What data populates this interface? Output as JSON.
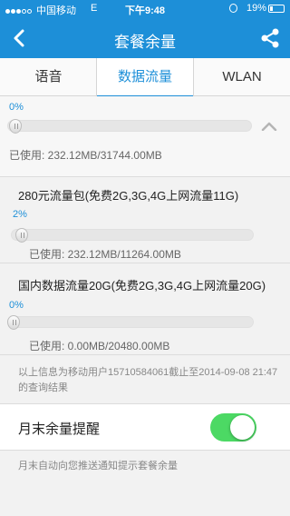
{
  "status": {
    "carrier": "中国移动",
    "network": "E",
    "time": "下午9:48",
    "battery": "19%"
  },
  "nav": {
    "title": "套餐余量",
    "back_icon": "chevron-left-icon",
    "share_icon": "share-icon"
  },
  "tabs": [
    {
      "label": "语音",
      "active": false
    },
    {
      "label": "数据流量",
      "active": true
    },
    {
      "label": "WLAN",
      "active": false
    }
  ],
  "summary": {
    "percent": "0%",
    "used": "已使用: 232.12MB/31744.00MB",
    "progress": 0.0073
  },
  "packages": [
    {
      "name": "280元流量包(免费2G,3G,4G上网流量11G)",
      "percent": "2%",
      "used": "已使用: 232.12MB/11264.00MB",
      "progress": 0.0206
    },
    {
      "name": "国内数据流量20G(免费2G,3G,4G上网流量20G)",
      "percent": "0%",
      "used": "已使用: 0.00MB/20480.00MB",
      "progress": 0
    }
  ],
  "info": "以上信息为移动用户15710584061截止至2014-09-08 21:47的查询结果",
  "reminder": {
    "label": "月末余量提醒",
    "enabled": true
  },
  "note": "月末自动向您推送通知提示套餐余量",
  "colors": {
    "brand": "#1d8fd8",
    "toggle_on": "#4cd964"
  }
}
